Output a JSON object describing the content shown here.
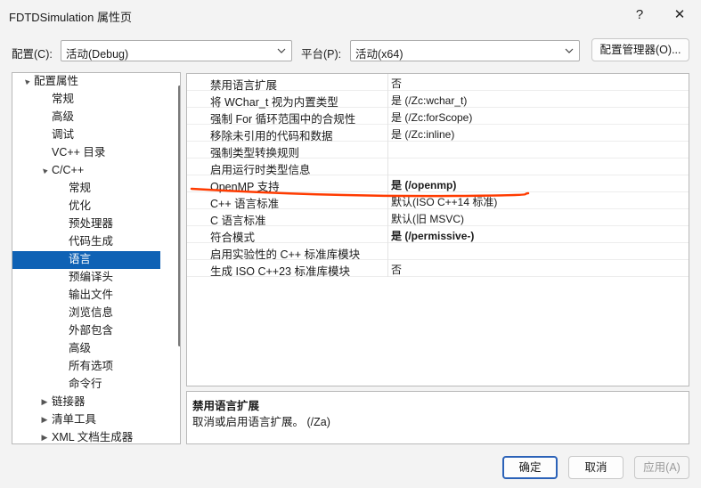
{
  "window": {
    "title": "FDTDSimulation 属性页",
    "help_glyph": "?",
    "close_glyph": "✕"
  },
  "config": {
    "config_label": "配置(C):",
    "config_value": "活动(Debug)",
    "platform_label": "平台(P):",
    "platform_value": "活动(x64)",
    "manager_label": "配置管理器(O)..."
  },
  "tree": {
    "items": [
      {
        "label": "配置属性",
        "level": 0,
        "expander": "▲"
      },
      {
        "label": "常规",
        "level": 1,
        "expander": ""
      },
      {
        "label": "高级",
        "level": 1,
        "expander": ""
      },
      {
        "label": "调试",
        "level": 1,
        "expander": ""
      },
      {
        "label": "VC++ 目录",
        "level": 1,
        "expander": ""
      },
      {
        "label": "C/C++",
        "level": 1,
        "expander": "▲"
      },
      {
        "label": "常规",
        "level": 2,
        "expander": ""
      },
      {
        "label": "优化",
        "level": 2,
        "expander": ""
      },
      {
        "label": "预处理器",
        "level": 2,
        "expander": ""
      },
      {
        "label": "代码生成",
        "level": 2,
        "expander": ""
      },
      {
        "label": "语言",
        "level": 2,
        "expander": "",
        "selected": true
      },
      {
        "label": "预编译头",
        "level": 2,
        "expander": ""
      },
      {
        "label": "输出文件",
        "level": 2,
        "expander": ""
      },
      {
        "label": "浏览信息",
        "level": 2,
        "expander": ""
      },
      {
        "label": "外部包含",
        "level": 2,
        "expander": ""
      },
      {
        "label": "高级",
        "level": 2,
        "expander": ""
      },
      {
        "label": "所有选项",
        "level": 2,
        "expander": ""
      },
      {
        "label": "命令行",
        "level": 2,
        "expander": ""
      },
      {
        "label": "链接器",
        "level": 1,
        "expander": "▶"
      },
      {
        "label": "清单工具",
        "level": 1,
        "expander": "▶"
      },
      {
        "label": "XML 文档生成器",
        "level": 1,
        "expander": "▶"
      }
    ]
  },
  "properties": [
    {
      "name": "禁用语言扩展",
      "value": "否",
      "bold": false
    },
    {
      "name": "将 WChar_t 视为内置类型",
      "value": "是 (/Zc:wchar_t)",
      "bold": false
    },
    {
      "name": "强制 For 循环范围中的合规性",
      "value": "是 (/Zc:forScope)",
      "bold": false
    },
    {
      "name": "移除未引用的代码和数据",
      "value": "是 (/Zc:inline)",
      "bold": false
    },
    {
      "name": "强制类型转换规则",
      "value": "",
      "bold": false
    },
    {
      "name": "启用运行时类型信息",
      "value": "",
      "bold": false
    },
    {
      "name": "OpenMP 支持",
      "value": "是 (/openmp)",
      "bold": true
    },
    {
      "name": "C++ 语言标准",
      "value": "默认(ISO C++14 标准)",
      "bold": false
    },
    {
      "name": "C 语言标准",
      "value": "默认(旧 MSVC)",
      "bold": false
    },
    {
      "name": "符合模式",
      "value": "是 (/permissive-)",
      "bold": true
    },
    {
      "name": "启用实验性的 C++ 标准库模块",
      "value": "",
      "bold": false
    },
    {
      "name": "生成 ISO C++23 标准库模块",
      "value": "否",
      "bold": false
    }
  ],
  "description": {
    "title": "禁用语言扩展",
    "text": "取消或启用语言扩展。     (/Za)"
  },
  "buttons": {
    "ok": "确定",
    "cancel": "取消",
    "apply": "应用(A)"
  },
  "colors": {
    "selection": "#0f62b5",
    "annotation_stroke": "#ff3b00"
  }
}
